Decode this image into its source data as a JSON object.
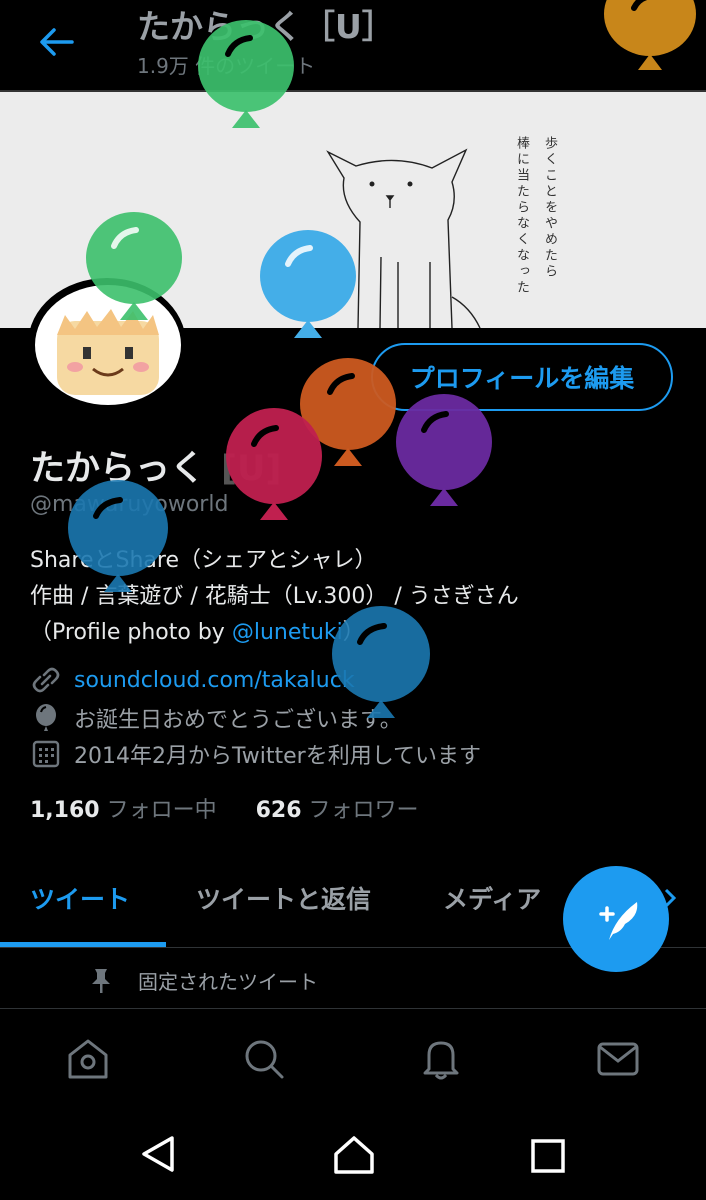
{
  "header": {
    "display_name": "たからっく［U］",
    "tweet_count": "1.9万 件のツイート"
  },
  "banner": {
    "line1": "歩くことをやめたら",
    "line2": "棒に当たらなくなった"
  },
  "profile": {
    "edit_button": "プロフィールを編集",
    "name": "たからっく",
    "name_suffix": "[U]",
    "handle": "@mawaruyoworld",
    "bio_line1": "ShareとShare（シェアとシャレ）",
    "bio_line2": "作曲 / 言葉遊び / 花騎士（Lv.300） / うさぎさん",
    "bio_line3_prefix": "（Profile photo by ",
    "bio_line3_link": "@lunetuki",
    "bio_line3_suffix": "）",
    "website": "soundcloud.com/takaluck",
    "birthday": "お誕生日おめでとうございます。",
    "joined": "2014年2月からTwitterを利用しています",
    "following_count": "1,160",
    "following_label": "フォロー中",
    "followers_count": "626",
    "followers_label": "フォロワー"
  },
  "tabs": [
    {
      "label": "ツイート",
      "active": true
    },
    {
      "label": "ツイートと返信",
      "active": false
    },
    {
      "label": "メディア",
      "active": false
    }
  ],
  "pinned_label": "固定されたツイート",
  "icons": {
    "back": "arrow-left-icon",
    "link": "link-icon",
    "birthday": "balloon-icon",
    "calendar": "calendar-icon",
    "pin": "pin-icon",
    "home": "home-icon",
    "search": "search-icon",
    "notifications": "bell-icon",
    "messages": "mail-icon",
    "compose": "compose-tweet-icon"
  },
  "colors": {
    "accent": "#1d9bf0",
    "background": "#000000",
    "balloon_green": "#3cc06c",
    "balloon_blue": "#44aee8",
    "balloon_orange": "#cc5a20",
    "balloon_red": "#c0204f",
    "balloon_purple": "#6a2aa0",
    "balloon_gold": "#c8861a"
  }
}
